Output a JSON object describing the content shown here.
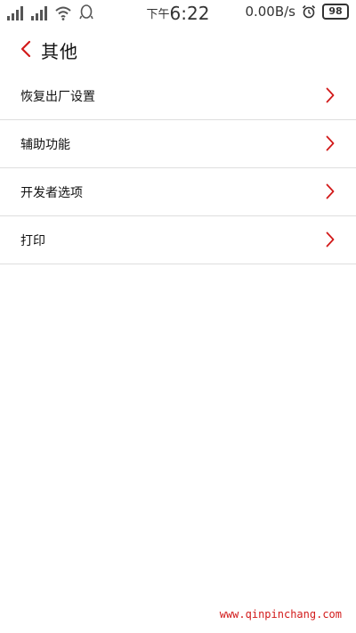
{
  "status_bar": {
    "time_prefix": "下午",
    "time": "6:22",
    "net_speed": "0.00B/s",
    "battery": "98",
    "icons": [
      "signal-icon",
      "signal-icon",
      "wifi-icon",
      "qq-icon",
      "alarm-icon",
      "battery-icon"
    ]
  },
  "header": {
    "title": "其他",
    "back_icon": "chevron-left-icon"
  },
  "items": [
    {
      "label": "恢复出厂设置"
    },
    {
      "label": "辅助功能"
    },
    {
      "label": "开发者选项"
    },
    {
      "label": "打印"
    }
  ],
  "watermark": "www.qinpinchang.com",
  "colors": {
    "accent": "#d21a1a",
    "divider": "#dedede",
    "text": "#111111"
  }
}
